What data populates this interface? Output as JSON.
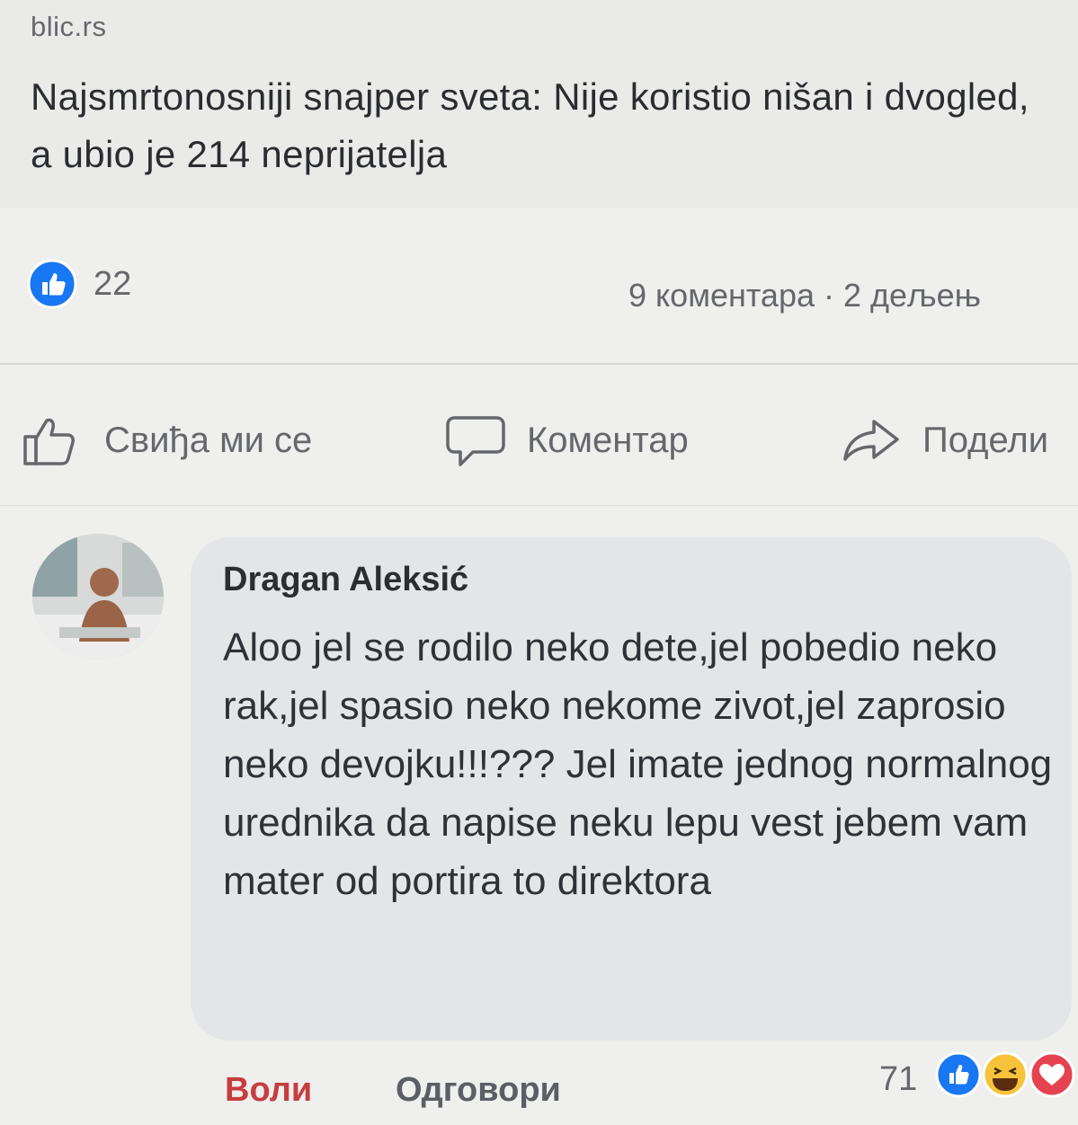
{
  "post": {
    "source": "blic.rs",
    "headline": "Najsmrtonosniji snajper sveta: Nije koristio nišan i dvogled, a ubio je 214 neprijatelja"
  },
  "stats": {
    "likes": "22",
    "comments_shares": "9 коментара · 2 дељењ"
  },
  "actions": {
    "like": "Свиђа ми се",
    "comment": "Коментар",
    "share": "Подели"
  },
  "comment": {
    "author": "Dragan Aleksić",
    "text": "Aloo jel se rodilo neko dete,jel pobedio neko rak,jel spasio neko nekome zivot,jel zaprosio neko devojku!!!??? Jel imate jednog normalnog urednika da napise neku lepu vest jebem vam mater od portira to direktora",
    "like_label": "Воли",
    "reply_label": "Одговори",
    "reaction_count": "71"
  },
  "icons": {
    "like_badge": "thumbs-up-badge-icon",
    "like_action": "thumbs-up-outline-icon",
    "comment_action": "speech-bubble-icon",
    "share_action": "share-arrow-icon",
    "reactions": [
      "like-reaction-icon",
      "haha-reaction-icon",
      "love-reaction-icon"
    ]
  },
  "colors": {
    "like_blue": "#1877f2",
    "love_red": "#e4434f",
    "haha_yellow": "#f7c33b",
    "muted_text": "#65676b"
  }
}
